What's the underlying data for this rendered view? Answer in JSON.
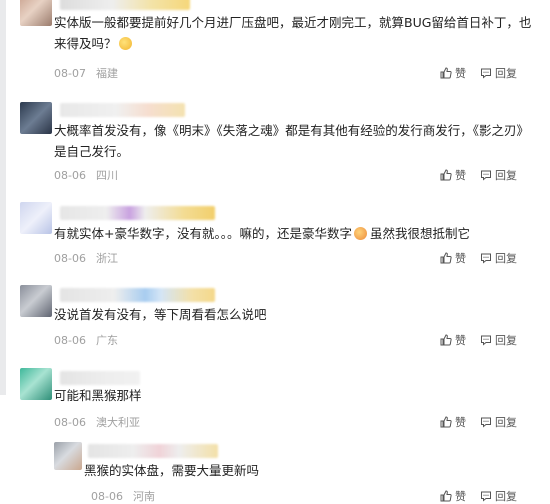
{
  "comments": [
    {
      "text": "实体版一般都要提前好几个月进厂压盘吧，最近才刚完工，就算BUG留给首日补丁，也来得及吗？",
      "date": "08-07",
      "location": "福建",
      "like_label": "赞",
      "reply_label": "回复"
    },
    {
      "text": "大概率首发没有，像《明末》《失落之魂》都是有其他有经验的发行商发行，《影之刃》是自己发行。",
      "date": "08-06",
      "location": "四川",
      "like_label": "赞",
      "reply_label": "回复"
    },
    {
      "text": "有就实体+豪华数字，没有就。。。嘛的，还是豪华数字",
      "text_tail": "虽然我很想抵制它",
      "date": "08-06",
      "location": "浙江",
      "like_label": "赞",
      "reply_label": "回复"
    },
    {
      "text": "没说首发有没有，等下周看看怎么说吧",
      "date": "08-06",
      "location": "广东",
      "like_label": "赞",
      "reply_label": "回复"
    },
    {
      "text": "可能和黑猴那样",
      "date": "08-06",
      "location": "澳大利亚",
      "like_label": "赞",
      "reply_label": "回复"
    }
  ],
  "reply": {
    "text": "黑猴的实体盘，需要大量更新吗",
    "date": "08-06",
    "location": "河南",
    "like_label": "赞",
    "reply_label": "回复"
  },
  "colors": {
    "meta_text": "#a0a0a0",
    "body_text": "#222222",
    "action_text": "#555555",
    "left_bar": "#e9eaec"
  }
}
